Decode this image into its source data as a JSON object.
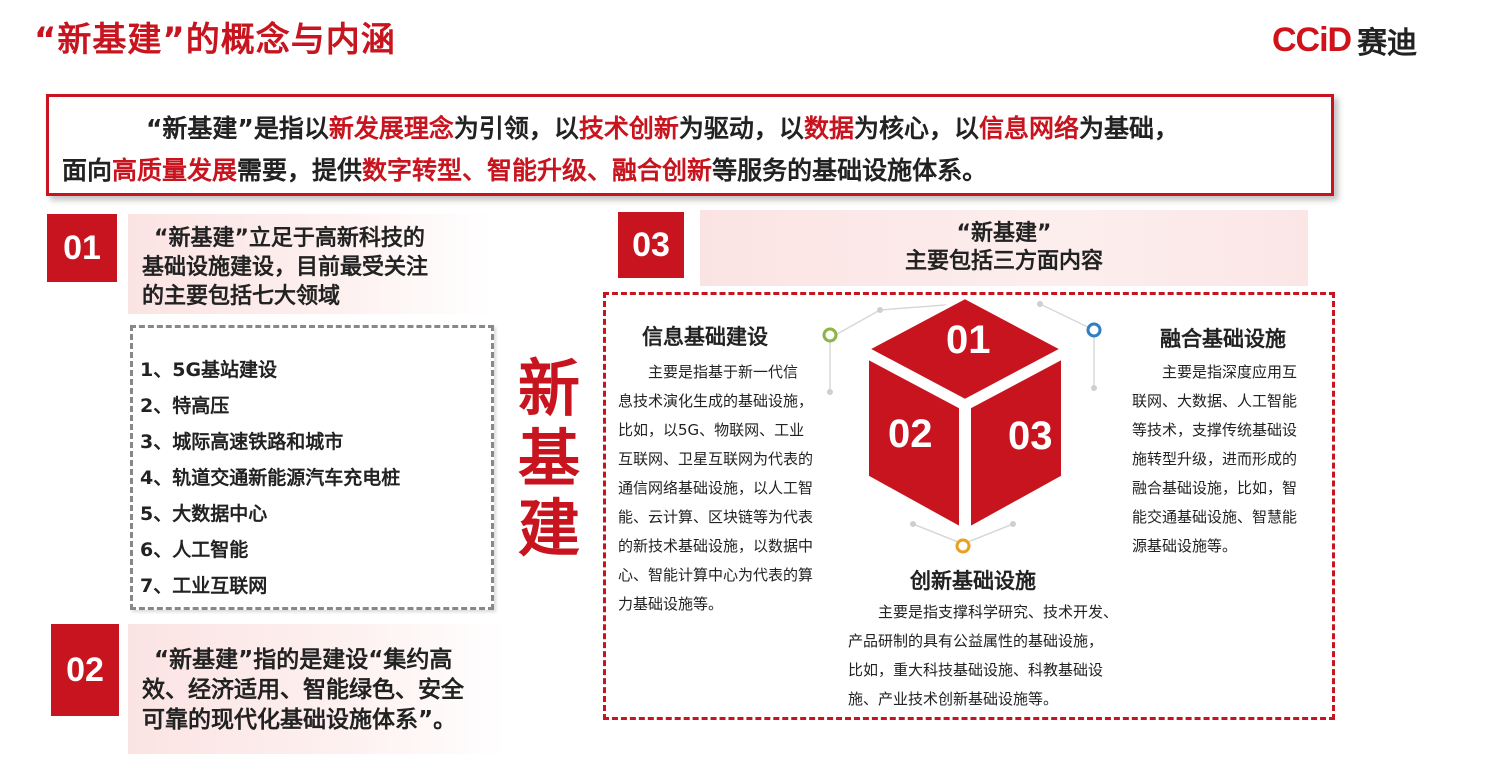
{
  "header": {
    "title": "“新基建”的概念与内涵",
    "logo_mark": "CCiD",
    "logo_text": "赛迪"
  },
  "definition": {
    "line1": [
      {
        "t": "“新基建”是指以",
        "hl": false
      },
      {
        "t": "新发展理念",
        "hl": true
      },
      {
        "t": "为引领，以",
        "hl": false
      },
      {
        "t": "技术创新",
        "hl": true
      },
      {
        "t": "为驱动，以",
        "hl": false
      },
      {
        "t": "数据",
        "hl": true
      },
      {
        "t": "为核心，以",
        "hl": false
      },
      {
        "t": "信息网络",
        "hl": true
      },
      {
        "t": "为基础，",
        "hl": false
      }
    ],
    "line2": [
      {
        "t": "面向",
        "hl": false
      },
      {
        "t": "高质量发展",
        "hl": true
      },
      {
        "t": "需要，提供",
        "hl": false
      },
      {
        "t": "数字转型、智能升级、融合创新",
        "hl": true
      },
      {
        "t": "等服务的基础设施体系。",
        "hl": false
      }
    ],
    "highlight_color": "#c8141e"
  },
  "point01": {
    "num": "01",
    "lines": [
      "“新基建”立足于高新科技的",
      "基础设施建设，目前最受关注",
      "的主要包括七大领域"
    ]
  },
  "fields": [
    "1、5G基站建设",
    "2、特高压",
    "3、城际高速铁路和城市",
    "4、轨道交通新能源汽车充电桩",
    "5、大数据中心",
    "6、人工智能",
    "7、工业互联网"
  ],
  "point02": {
    "num": "02",
    "lines": [
      "“新基建”指的是建设“集约高",
      "效、经济适用、智能绿色、安全",
      "可靠的现代化基础设施体系”。"
    ]
  },
  "vertical_title": [
    "新",
    "基",
    "建"
  ],
  "point03": {
    "num": "03",
    "lines": [
      "“新基建”",
      "主要包括三方面内容"
    ]
  },
  "cube": {
    "top": "01",
    "left": "02",
    "right": "03"
  },
  "sections": {
    "info": {
      "title": "信息基础建设",
      "lines": [
        "主要是指基于新一代信",
        "息技术演化生成的基础设施，",
        "比如，以5G、物联网、工业",
        "互联网、卫星互联网为代表的",
        "通信网络基础设施，以人工智",
        "能、云计算、区块链等为代表",
        "的新技术基础设施，以数据中",
        "心、智能计算中心为代表的算",
        "力基础设施等。"
      ]
    },
    "fusion": {
      "title": "融合基础设施",
      "lines": [
        "主要是指深度应用互",
        "联网、大数据、人工智能",
        "等技术，支撑传统基础设",
        "施转型升级，进而形成的",
        "融合基础设施，比如，智",
        "能交通基础设施、智慧能",
        "源基础设施等。"
      ]
    },
    "innovation": {
      "title": "创新基础设施",
      "lines": [
        "主要是指支撑科学研究、技术开发、",
        "产品研制的具有公益属性的基础设施，",
        "比如，重大科技基础设施、科教基础设",
        "施、产业技术创新基础设施等。"
      ]
    }
  },
  "colors": {
    "primary_red": "#c8141e",
    "dot_green": "#8bb544",
    "dot_blue": "#2f7dc2",
    "dot_orange": "#e8a020"
  }
}
